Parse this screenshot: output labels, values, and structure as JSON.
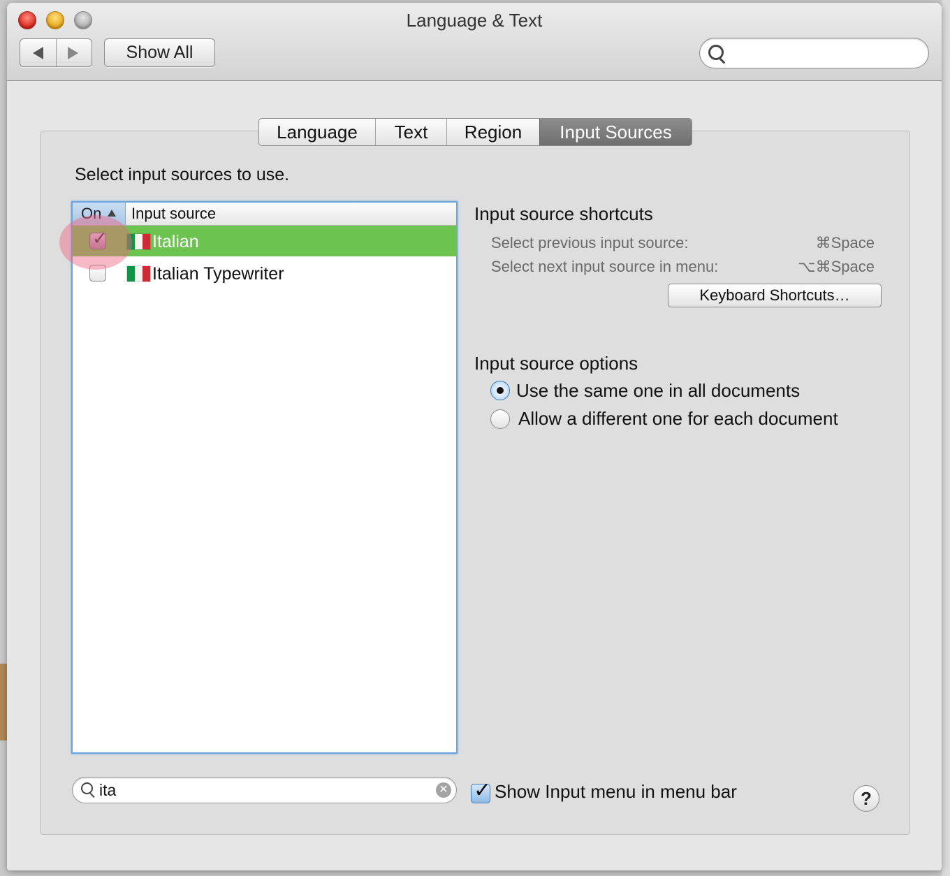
{
  "window": {
    "title": "Language & Text"
  },
  "toolbar": {
    "show_all_label": "Show All",
    "back_icon": "back-arrow-icon",
    "forward_icon": "forward-arrow-icon",
    "search_placeholder": "",
    "search_value": ""
  },
  "tabs": [
    {
      "label": "Language",
      "selected": false
    },
    {
      "label": "Text",
      "selected": false
    },
    {
      "label": "Region",
      "selected": false
    },
    {
      "label": "Input Sources",
      "selected": true
    }
  ],
  "main": {
    "instruction": "Select input sources to use.",
    "table": {
      "columns": {
        "on": "On",
        "source": "Input source"
      },
      "rows": [
        {
          "checked": true,
          "label": "Italian",
          "selected": true,
          "flag": "italy-flag-icon"
        },
        {
          "checked": false,
          "label": "Italian Typewriter",
          "selected": false,
          "flag": "italy-flag-icon"
        }
      ]
    },
    "filter_search": {
      "value": "ita"
    }
  },
  "shortcuts": {
    "title": "Input source shortcuts",
    "items": [
      {
        "label": "Select previous input source:",
        "key": "⌘Space"
      },
      {
        "label": "Select next input source in menu:",
        "key": "⌥⌘Space"
      }
    ],
    "button_label": "Keyboard Shortcuts…"
  },
  "options": {
    "title": "Input source options",
    "radios": [
      {
        "label": "Use the same one in all documents",
        "selected": true
      },
      {
        "label": "Allow a different one for each document",
        "selected": false
      }
    ]
  },
  "footer": {
    "show_menu_label": "Show Input menu in menu bar",
    "show_menu_checked": true,
    "help_label": "?"
  },
  "colors": {
    "selection_green": "#6cc34f",
    "focus_blue": "#6aa6dd",
    "selected_tab": "#7d7d7d"
  }
}
